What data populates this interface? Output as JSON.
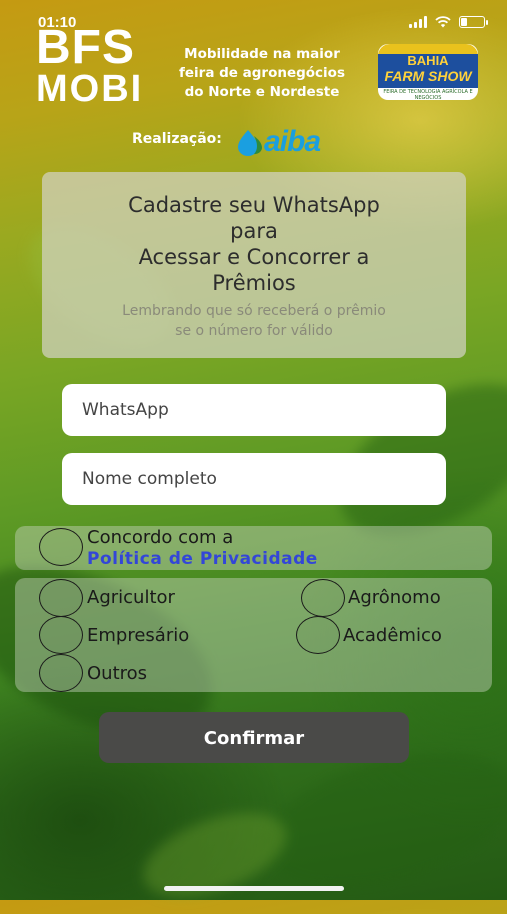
{
  "status_bar": {
    "time": "01:10"
  },
  "header": {
    "logo_line1": "BFS",
    "logo_line2": "MOBI",
    "tagline": [
      "Mobilidade na maior",
      "feira de agronegócios",
      "do Norte e Nordeste"
    ],
    "partner_logo": {
      "line1": "BAHIA",
      "line2": "FARM SHOW",
      "line3": "FEIRA DE TECNOLOGIA AGRÍCOLA E NEGÓCIOS"
    },
    "realizacao_label": "Realização:",
    "realizacao_logo": "aiba"
  },
  "card": {
    "title_lines": [
      "Cadastre seu WhatsApp",
      "para",
      "Acessar e Concorrer a",
      "Prêmios"
    ],
    "note_lines": [
      "Lembrando que só receberá o prêmio",
      "se o número for válido"
    ]
  },
  "form": {
    "whatsapp_placeholder": "WhatsApp",
    "name_placeholder": "Nome completo",
    "privacy": {
      "text": "Concordo com a",
      "link": "Política de Privacidade"
    },
    "roles": [
      "Agricultor",
      "Agrônomo",
      "Empresário",
      "Acadêmico",
      "Outros"
    ],
    "confirm_label": "Confirmar"
  },
  "colors": {
    "link": "#3346d8",
    "button": "#4a4a48",
    "aiba": "#1a9fe0"
  }
}
